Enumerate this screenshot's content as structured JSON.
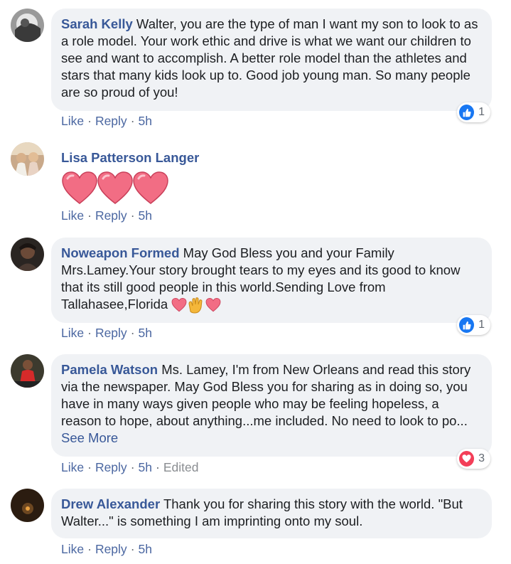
{
  "comments": [
    {
      "author": "Sarah Kelly",
      "text": "Walter, you are the type of man I want my son to look to as a role model. Your work ethic and drive is what we want our children to see and want to accomplish. A better role model than the athletes and stars that many kids look up to. Good job young man. So many people are so proud of you!",
      "like": "Like",
      "reply": "Reply",
      "time": "5h",
      "reaction": {
        "type": "like-icon",
        "count": "1"
      }
    },
    {
      "author": "Lisa Patterson Langer",
      "text": "",
      "like": "Like",
      "reply": "Reply",
      "time": "5h"
    },
    {
      "author": "Noweapon Formed",
      "text": "May God Bless you and your Family Mrs.Lamey.Your story brought tears to my eyes and its good to know that its still good people in this world.Sending Love from Tallahasee,Florida",
      "like": "Like",
      "reply": "Reply",
      "time": "5h",
      "reaction": {
        "type": "like-icon",
        "count": "1"
      }
    },
    {
      "author": "Pamela Watson",
      "text": "Ms. Lamey, I'm from New Orleans and read this story via the newspaper. May God Bless you for sharing as in doing so, you have in many ways given people who may be feeling hopeless, a reason to hope, about anything...me included. No need to look to po...",
      "see_more": "See More",
      "like": "Like",
      "reply": "Reply",
      "time": "5h",
      "edited": "Edited",
      "reaction": {
        "type": "love-icon",
        "count": "3"
      }
    },
    {
      "author": "Drew Alexander",
      "text": "Thank you for sharing this story with the world. \"But Walter...\" is something I am imprinting onto my soul.",
      "like": "Like",
      "reply": "Reply",
      "time": "5h"
    }
  ],
  "colors": {
    "name": "#385898",
    "bubble": "#f0f2f5",
    "like_blue": "#1877f2",
    "love_red": "#f33e58",
    "heart": "#f06a80"
  }
}
